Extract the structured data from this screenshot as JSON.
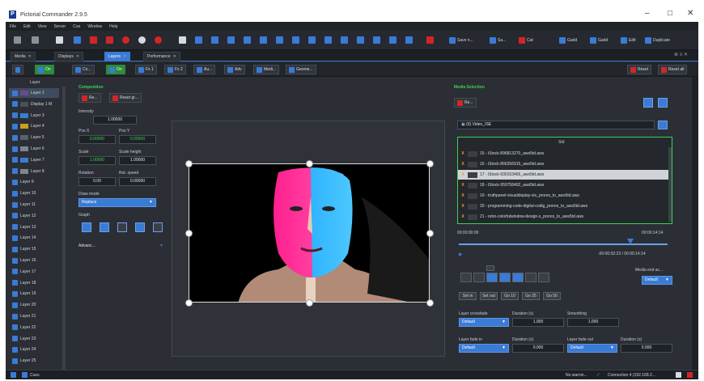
{
  "window": {
    "title": "Pictorial Commander 2.9.5",
    "app_icon": "P"
  },
  "menu": [
    "File",
    "Edit",
    "View",
    "Server",
    "Cue",
    "Window",
    "Help"
  ],
  "toolbar": {
    "save_label": "Save n...",
    "save_as_label": "Sa...",
    "cat_label": "Cat",
    "gaddr_label": "Gadd",
    "gaddr2_label": "Gadd",
    "edit_label": "Edit",
    "duplicate_label": "Duplicate"
  },
  "tabs": [
    {
      "label": "Media"
    },
    {
      "label": "Displays"
    },
    {
      "label": "Layers"
    },
    {
      "label": "Performance"
    }
  ],
  "subbar": {
    "btn_on": "On",
    "btn_co": "Co...",
    "btn_on2": "On",
    "btn_fx1": "Fx 1",
    "btn_fx2": "Fx 2",
    "btn_au": "Au...",
    "btn_adv": "Adv",
    "btn_medi": "Medi...",
    "btn_geome": "Geome...",
    "reset": "Reset",
    "reset_all": "Reset all"
  },
  "layers": {
    "header": "Layer",
    "items": [
      "Layer 1",
      "Display 1 M",
      "Layer 3",
      "Layer 4",
      "Layer 5",
      "Layer 6",
      "Layer 7",
      "Layer 8",
      "Layer 9",
      "Layer 10",
      "Layer 11",
      "Layer 12",
      "Layer 13",
      "Layer 14",
      "Layer 15",
      "Layer 16",
      "Layer 17",
      "Layer 18",
      "Layer 19",
      "Layer 20",
      "Layer 21",
      "Layer 22",
      "Layer 23",
      "Layer 24",
      "Layer 25"
    ]
  },
  "composition": {
    "header": "Composition",
    "btn_re": "Re...",
    "btn_reset_geo": "Reset gr...",
    "intensity_label": "Intensity",
    "intensity": "1.00000",
    "posx_label": "Pos X",
    "posy_label": "Pos Y",
    "posx": "0.00000",
    "posy": "0.00000",
    "scale_label": "Scale",
    "scale_height_label": "Scale height",
    "scale": "1.00000",
    "scale_height": "1.00000",
    "rotation_label": "Rotation",
    "rot_speed_label": "Rot. speed",
    "rotation": "0.00",
    "rot_speed": "0.00000",
    "draw_mode_label": "Draw mode",
    "draw_mode": "Replace",
    "graph_label": "Graph",
    "advanced_label": "Advanc..."
  },
  "media": {
    "header": "Media Selection",
    "btn_re": "Re...",
    "folder": "(0) Video_ISE",
    "list_header": "Std",
    "items": [
      "15 - iStock-896813270_aws5td.aws",
      "16 - iStock-866356915_aws5td.aws",
      "17 - iStock-930153466_aws5td.aws",
      "18 - iStock-959758492_aws5td.aws",
      "19 - truthpanel-visualdisplay-vis_prores_to_aws5td.aws",
      "20 - programming-code-digital-codig_prores_to_aws5td.aws",
      "21 - retro-colorfulwindow-design-s_prores_to_aws5td.aws"
    ],
    "time_start": "00:00:00:00",
    "time_end": "00:00:14:14",
    "time_remaining": "-00:00:02:23 / 00:00:14:14",
    "playhead": 0.82,
    "media_end_label": "Media end ac...",
    "media_end_value": "Default",
    "set_buttons": [
      "Set in",
      "Set out",
      "Go 10",
      "Go 25",
      "Go 50"
    ],
    "crossfade_label": "Layer crossfade",
    "duration_label": "Duration (s)",
    "smoothing_label": "Smoothing",
    "crossfade_value": "Default",
    "crossfade_duration": "1.000",
    "smoothing": "1.000",
    "fade_in_label": "Layer fade in",
    "fade_in_duration_label": "Duration (s)",
    "fade_out_label": "Layer fade out",
    "fade_out_duration_label": "Duration (s)",
    "fade_in_value": "Default",
    "fade_in_duration": "0.000",
    "fade_out_value": "Default",
    "fade_out_duration": "0.000"
  },
  "statusbar": {
    "cues_label": "Cues",
    "warning": "No warnin...",
    "connection": "Connection 4 (192.168.2..."
  },
  "colors": {
    "accent": "#3a7bd5",
    "green": "#39d353",
    "red": "#d22626",
    "bg": "#2b2f35"
  }
}
